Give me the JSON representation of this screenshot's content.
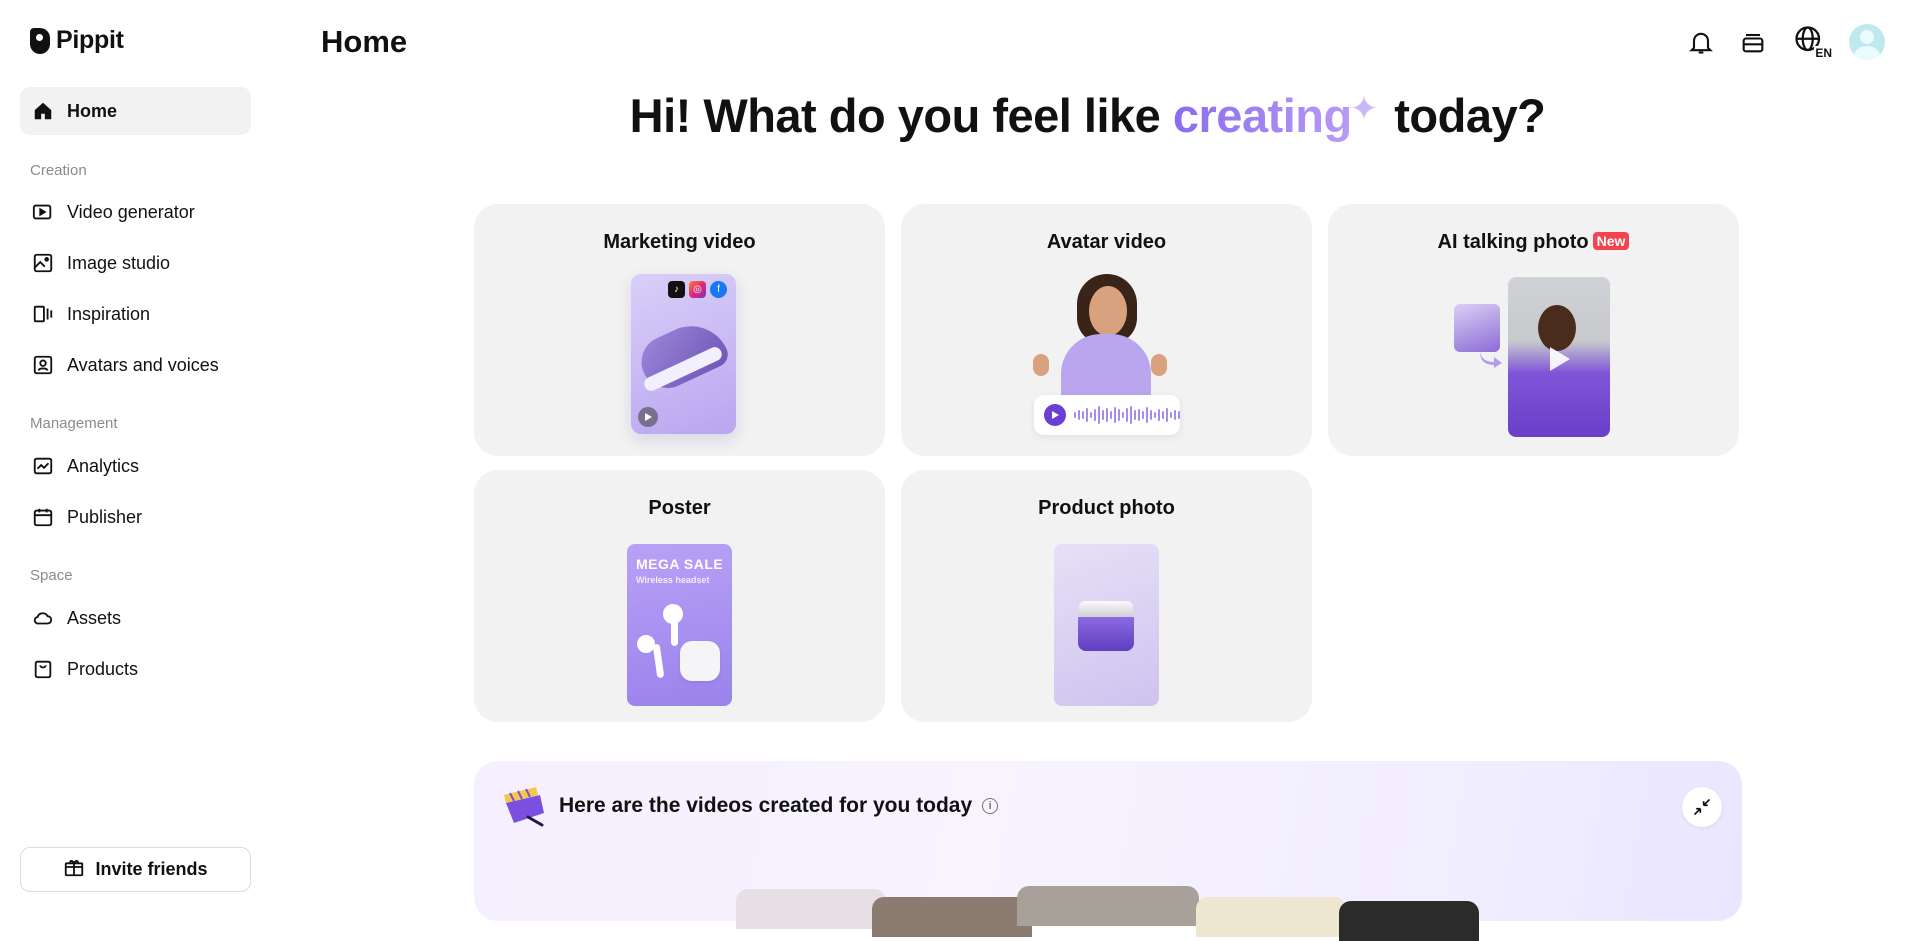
{
  "app": {
    "name": "Pippit"
  },
  "sidebar": {
    "home_label": "Home",
    "sections": [
      {
        "title": "Creation",
        "items": [
          "Video generator",
          "Image studio",
          "Inspiration",
          "Avatars and voices"
        ]
      },
      {
        "title": "Management",
        "items": [
          "Analytics",
          "Publisher"
        ]
      },
      {
        "title": "Space",
        "items": [
          "Assets",
          "Products"
        ]
      }
    ],
    "invite_label": "Invite friends"
  },
  "header": {
    "title": "Home",
    "language": "EN",
    "icons": [
      "bell-icon",
      "stack-icon",
      "globe-icon"
    ]
  },
  "greeting": {
    "before": "Hi! What do you feel like ",
    "highlight": "creating",
    "after": " today?"
  },
  "cards": [
    {
      "title": "Marketing video"
    },
    {
      "title": "Avatar video"
    },
    {
      "title": "AI talking photo",
      "badge": "New"
    },
    {
      "title": "Poster",
      "poster_title": "MEGA SALE",
      "poster_subtitle": "Wireless headset"
    },
    {
      "title": "Product photo"
    }
  ],
  "videos_banner": {
    "text": "Here are the videos created for you today"
  },
  "colors": {
    "accent": "#8a6cf0",
    "badge_red": "#f2434e",
    "card_bg": "#f2f2f2"
  }
}
